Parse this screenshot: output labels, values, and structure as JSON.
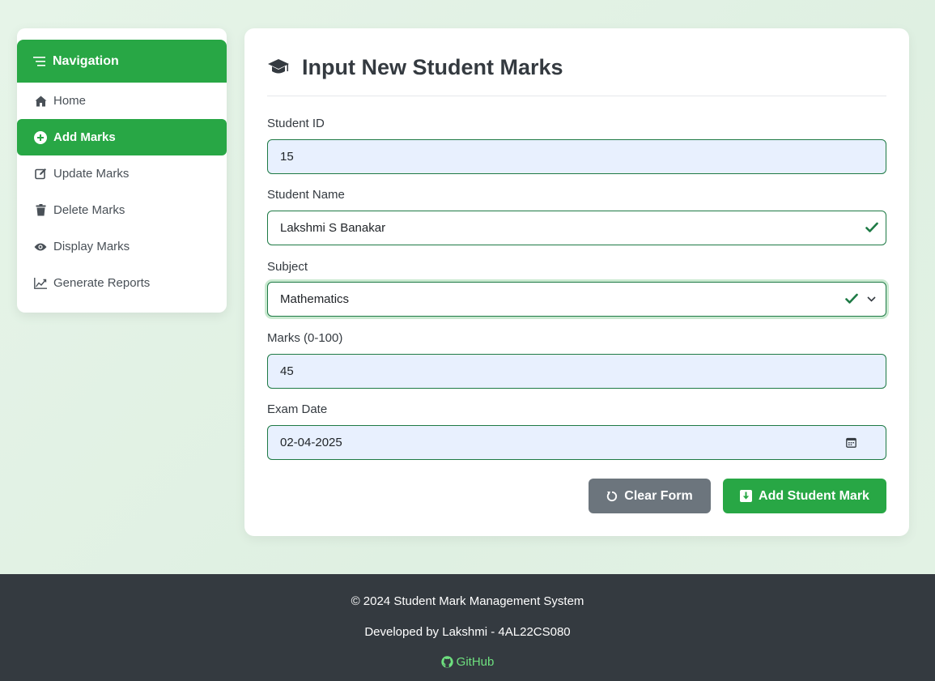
{
  "sidebar": {
    "header": "Navigation",
    "items": [
      {
        "label": "Home",
        "icon": "home-icon"
      },
      {
        "label": "Add Marks",
        "icon": "plus-circle-icon",
        "active": true
      },
      {
        "label": "Update Marks",
        "icon": "edit-icon"
      },
      {
        "label": "Delete Marks",
        "icon": "trash-icon"
      },
      {
        "label": "Display Marks",
        "icon": "eye-icon"
      },
      {
        "label": "Generate Reports",
        "icon": "chart-line-icon"
      }
    ]
  },
  "form": {
    "title": "Input New Student Marks",
    "title_icon": "graduation-cap-icon",
    "student_id": {
      "label": "Student ID",
      "value": "15"
    },
    "student_name": {
      "label": "Student Name",
      "value": "Lakshmi S Banakar"
    },
    "subject": {
      "label": "Subject",
      "value": "Mathematics"
    },
    "marks": {
      "label": "Marks (0-100)",
      "value": "45"
    },
    "exam_date": {
      "label": "Exam Date",
      "value": "02-04-2025"
    },
    "clear_button": "Clear Form",
    "submit_button": "Add Student Mark"
  },
  "footer": {
    "copyright": "© 2024 Student Mark Management System",
    "developer": "Developed by Lakshmi - 4AL22CS080",
    "link": "GitHub"
  },
  "colors": {
    "accent": "#28a745",
    "button_secondary": "#6c757d",
    "footer_bg": "#343a40",
    "footer_link": "#6ee07f",
    "valid_check": "#1e7a45"
  }
}
